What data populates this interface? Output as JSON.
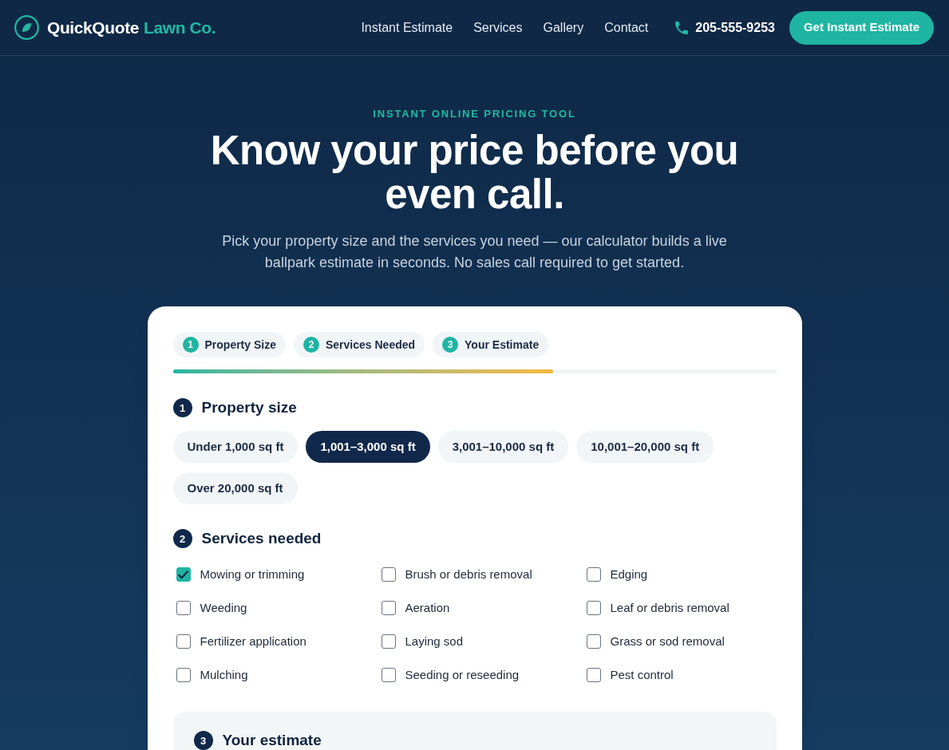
{
  "header": {
    "logo": {
      "name": "QuickQuote",
      "suffix": "Lawn Co."
    },
    "nav": [
      "Instant Estimate",
      "Services",
      "Gallery",
      "Contact"
    ],
    "phone": "205-555-9253",
    "cta": "Get Instant Estimate"
  },
  "hero": {
    "eyebrow": "INSTANT ONLINE PRICING TOOL",
    "title": "Know your price before you even call.",
    "subtitle": "Pick your property size and the services you need — our calculator builds a live ballpark estimate in seconds. No sales call required to get started."
  },
  "calculator": {
    "steps": [
      {
        "number": "1",
        "label": "Property Size"
      },
      {
        "number": "2",
        "label": "Services Needed"
      },
      {
        "number": "3",
        "label": "Your Estimate"
      }
    ],
    "progress": {
      "level": 0.63
    },
    "sections": [
      {
        "kind": "options",
        "number": "1",
        "title": "Property size",
        "options": [
          {
            "label": "Under 1,000 sq ft",
            "selected": false
          },
          {
            "label": "1,001–3,000 sq ft",
            "selected": true
          },
          {
            "label": "3,001–10,000 sq ft",
            "selected": false
          },
          {
            "label": "10,001–20,000 sq ft",
            "selected": false
          },
          {
            "label": "Over 20,000 sq ft",
            "selected": false
          }
        ]
      },
      {
        "kind": "checklist",
        "number": "2",
        "title": "Services needed",
        "items": [
          {
            "label": "Mowing or trimming",
            "checked": true
          },
          {
            "label": "Brush or debris removal",
            "checked": false
          },
          {
            "label": "Edging",
            "checked": false
          },
          {
            "label": "Weeding",
            "checked": false
          },
          {
            "label": "Aeration",
            "checked": false
          },
          {
            "label": "Leaf or debris removal",
            "checked": false
          },
          {
            "label": "Fertilizer application",
            "checked": false
          },
          {
            "label": "Laying sod",
            "checked": false
          },
          {
            "label": "Grass or sod removal",
            "checked": false
          },
          {
            "label": "Mulching",
            "checked": false
          },
          {
            "label": "Seeding or reseeding",
            "checked": false
          },
          {
            "label": "Pest control",
            "checked": false
          }
        ]
      }
    ],
    "estimate": {
      "number": "3",
      "title": "Your estimate"
    }
  }
}
